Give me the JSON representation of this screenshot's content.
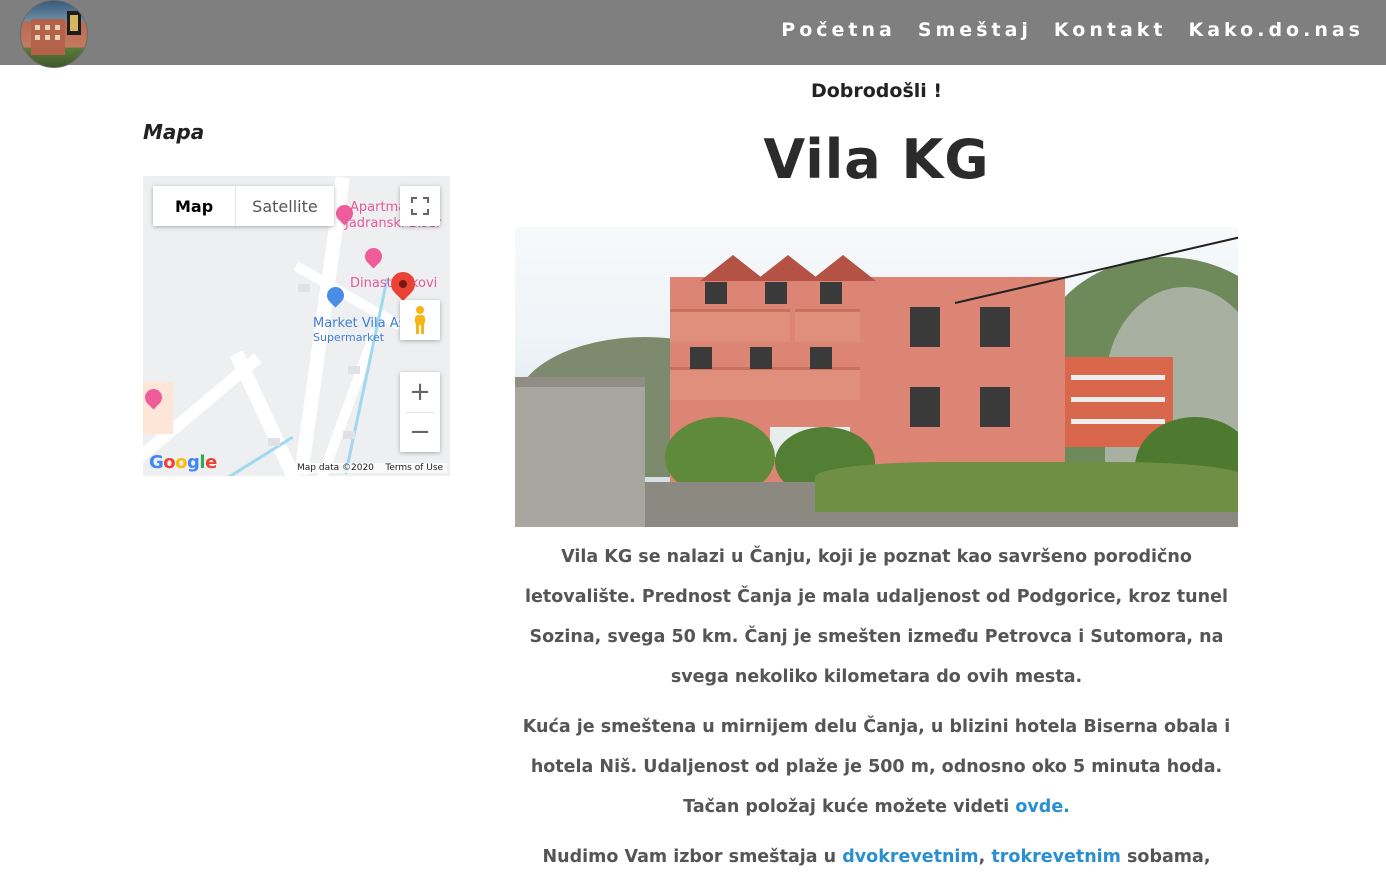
{
  "header": {
    "nav": [
      "Početna",
      "Smeštaj",
      "Kontakt",
      "Kako.do.nas"
    ]
  },
  "sidebar": {
    "title": "Mapa",
    "map": {
      "type_buttons": [
        "Map",
        "Satellite"
      ],
      "labels": {
        "apartment": "Apartma",
        "jadranski": "Jadranski Biser",
        "dinasti": "Dinasti Ivkovi",
        "market": "Market Vila As",
        "market_type": "Supermarket"
      },
      "google": "Google",
      "map_data": "Map data ©2020",
      "terms": "Terms of Use",
      "zoom_in": "+",
      "zoom_out": "−",
      "fullscreen_icon": "fullscreen-icon",
      "pegman_icon": "pegman-icon"
    }
  },
  "main": {
    "welcome": "Dobrodošli !",
    "title": "Vila KG",
    "paragraphs": {
      "p1": "Vila KG se nalazi u Čanju, koji je poznat kao savršeno porodično letovalište. Prednost Čanja je mala udaljenost od Podgorice, kroz tunel Sozina, svega 50 km. Čanj je smešten između Petrovca i Sutomora, na svega nekoliko kilometara do ovih mesta.",
      "p2_text": "Kuća je smeštena u mirnijem delu Čanja, u blizini hotela Biserna obala i hotela Niš. Udaljenost od plaže je 500 m, odnosno oko 5 minuta hoda. Tačan položaj kuće možete videti ",
      "p2_link": "ovde.",
      "p3_text": "Nudimo Vam izbor smeštaja u ",
      "p3_link1": "dvokrevetnim",
      "p3_sep": ", ",
      "p3_link2": "trokrevetnim",
      "p3_tail": " sobama,"
    }
  },
  "colors": {
    "header_bg": "#7f7f7f",
    "link": "#2a8fd0",
    "text": "#555555"
  }
}
